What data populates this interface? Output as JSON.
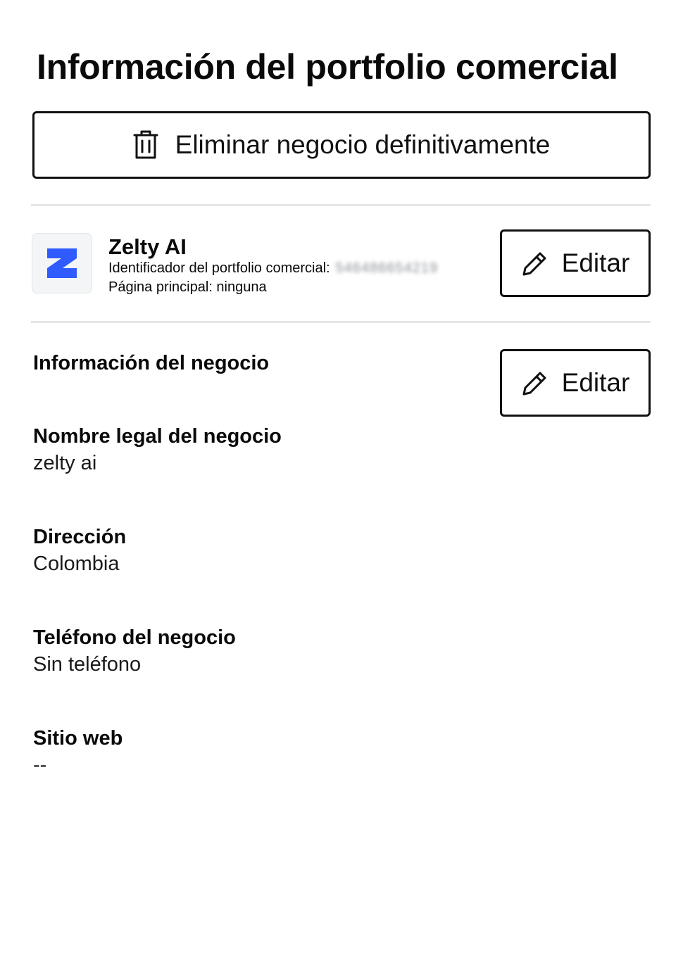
{
  "page": {
    "title": "Información del portfolio comercial",
    "delete_button_label": "Eliminar negocio definitivamente"
  },
  "business": {
    "name": "Zelty AI",
    "id_label": "Identificador del portfolio comercial:",
    "id_value": "546486654219",
    "homepage_text": "Página principal: ninguna",
    "edit_label": "Editar",
    "logo_color": "#2f5bff"
  },
  "info_section": {
    "title": "Información del negocio",
    "edit_label": "Editar",
    "fields": [
      {
        "label": "Nombre legal del negocio",
        "value": "zelty ai"
      },
      {
        "label": "Dirección",
        "value": "Colombia"
      },
      {
        "label": "Teléfono del negocio",
        "value": "Sin teléfono"
      },
      {
        "label": "Sitio web",
        "value": "--"
      }
    ]
  },
  "icons": {
    "delete": "trash-icon",
    "edit": "pencil-icon",
    "logo": "zelty-logo-icon"
  }
}
